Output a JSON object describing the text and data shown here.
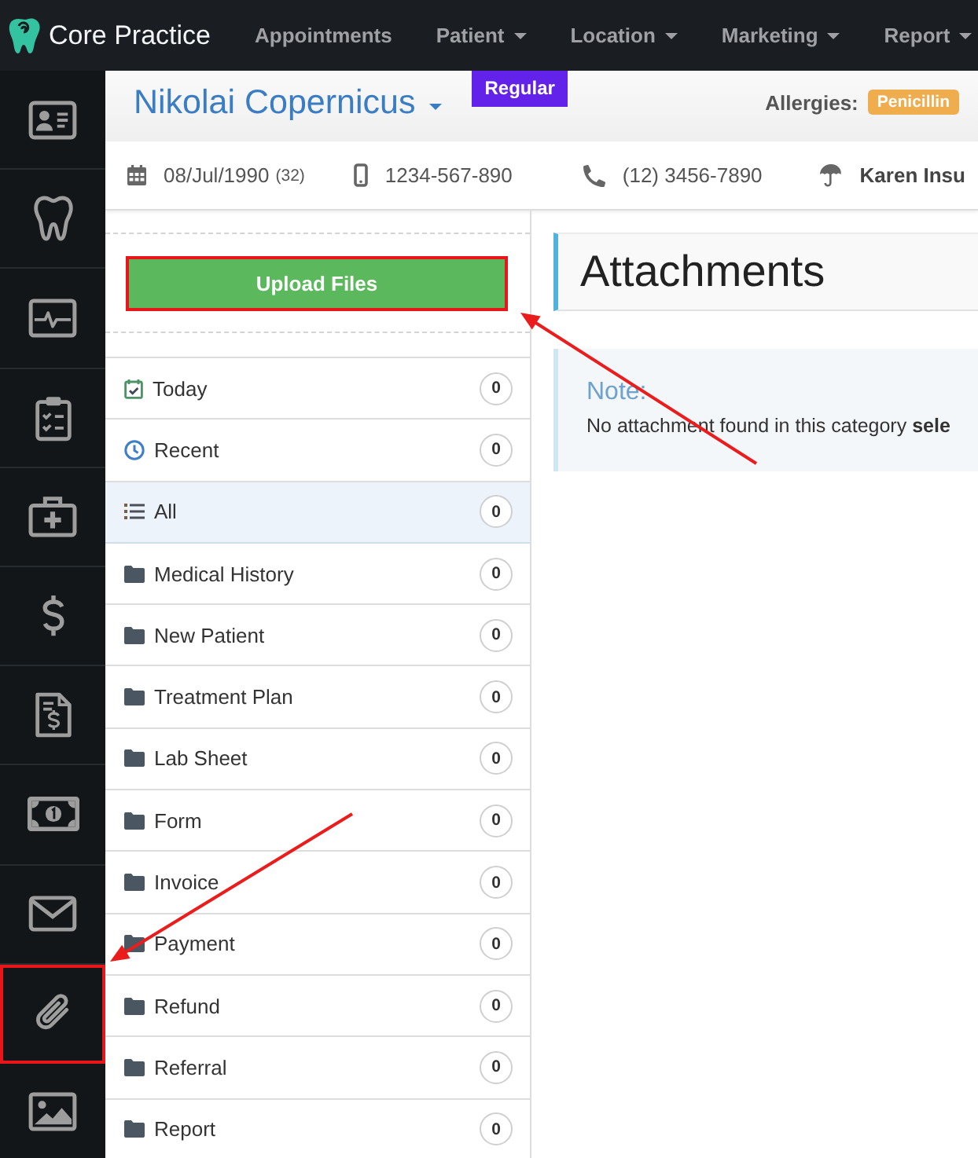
{
  "nav": {
    "brand": "Core Practice",
    "items": [
      {
        "label": "Appointments",
        "dropdown": false
      },
      {
        "label": "Patient",
        "dropdown": true
      },
      {
        "label": "Location",
        "dropdown": true
      },
      {
        "label": "Marketing",
        "dropdown": true
      },
      {
        "label": "Report",
        "dropdown": true
      }
    ]
  },
  "sidebar": {
    "items": [
      {
        "kind": "contact",
        "highlighted": false
      },
      {
        "kind": "tooth",
        "highlighted": false
      },
      {
        "kind": "monitor",
        "highlighted": false
      },
      {
        "kind": "clipboard",
        "highlighted": false
      },
      {
        "kind": "medkit",
        "highlighted": false
      },
      {
        "kind": "dollar",
        "highlighted": false
      },
      {
        "kind": "invoice",
        "highlighted": false
      },
      {
        "kind": "banknote",
        "highlighted": false
      },
      {
        "kind": "envelope",
        "highlighted": false
      },
      {
        "kind": "paperclip",
        "highlighted": true
      },
      {
        "kind": "image",
        "highlighted": false
      }
    ]
  },
  "patient": {
    "name": "Nikolai Copernicus",
    "dropdown": true,
    "tier_badge": "Regular",
    "allergies_label": "Allergies:",
    "allergies": [
      "Penicillin"
    ]
  },
  "details": [
    {
      "kind": "birthdate",
      "value": "08/Jul/1990",
      "extra": "(32)"
    },
    {
      "kind": "mobile",
      "value": "1234-567-890"
    },
    {
      "kind": "phone",
      "value": "(12) 3456-7890"
    },
    {
      "kind": "insurance",
      "value": "Karen Insu"
    }
  ],
  "upload_button": {
    "label": "Upload Files",
    "highlighted": true
  },
  "categories": [
    {
      "kind": "today",
      "label": "Today",
      "count": "0",
      "selected": false
    },
    {
      "kind": "recent",
      "label": "Recent",
      "count": "0",
      "selected": false
    },
    {
      "kind": "all",
      "label": "All",
      "count": "0",
      "selected": true
    },
    {
      "kind": "folder",
      "label": "Medical History",
      "count": "0",
      "selected": false
    },
    {
      "kind": "folder",
      "label": "New Patient",
      "count": "0",
      "selected": false
    },
    {
      "kind": "folder",
      "label": "Treatment Plan",
      "count": "0",
      "selected": false
    },
    {
      "kind": "folder",
      "label": "Lab Sheet",
      "count": "0",
      "selected": false
    },
    {
      "kind": "folder",
      "label": "Form",
      "count": "0",
      "selected": false
    },
    {
      "kind": "folder",
      "label": "Invoice",
      "count": "0",
      "selected": false
    },
    {
      "kind": "folder",
      "label": "Payment",
      "count": "0",
      "selected": false
    },
    {
      "kind": "folder",
      "label": "Refund",
      "count": "0",
      "selected": false
    },
    {
      "kind": "folder",
      "label": "Referral",
      "count": "0",
      "selected": false
    },
    {
      "kind": "folder",
      "label": "Report",
      "count": "0",
      "selected": false
    }
  ],
  "content": {
    "title": "Attachments",
    "note": {
      "title": "Note:",
      "text": "No attachment found in this category **sele**"
    }
  }
}
